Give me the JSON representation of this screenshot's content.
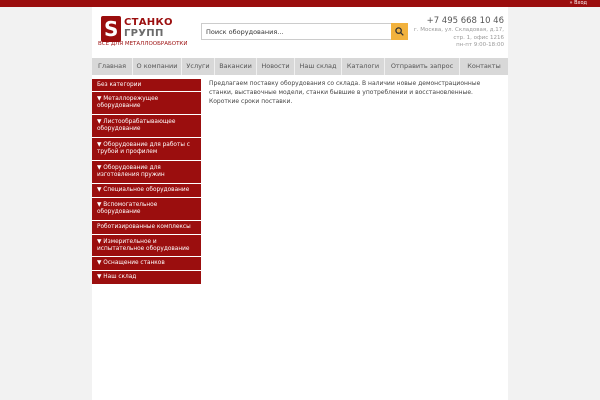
{
  "topbar": {
    "login_label": "» Вход"
  },
  "header": {
    "logo_line1": "СТАНКО",
    "logo_line2": "ГРУПП",
    "logo_mark": "S",
    "tagline": "ВСЁ ДЛЯ МЕТАЛЛООБРАБОТКИ",
    "search_placeholder": "Поиск оборудования...",
    "phone": "+7 495 668 10 46",
    "address_line1": "г. Москва, ул. Складовая, д.17,",
    "address_line2": "стр. 1, офис 1216",
    "hours": "пн-пт 9:00-18:00"
  },
  "nav": {
    "items": [
      {
        "label": "Главная"
      },
      {
        "label": "О компании"
      },
      {
        "label": "Услуги"
      },
      {
        "label": "Вакансии"
      },
      {
        "label": "Новости"
      },
      {
        "label": "Наш склад"
      },
      {
        "label": "Каталоги"
      },
      {
        "label": "Отправить запрос"
      },
      {
        "label": "Контакты"
      }
    ]
  },
  "sidebar": {
    "categories": [
      {
        "label": "Без категории"
      },
      {
        "label": "▼ Металлорежущее оборудование"
      },
      {
        "label": "▼ Листообрабатывающее оборудование"
      },
      {
        "label": "▼ Оборудование для работы с трубой и профилем"
      },
      {
        "label": "▼ Оборудование для изготовления пружин"
      },
      {
        "label": "▼ Специальное оборудование"
      },
      {
        "label": "▼ Вспомогательное оборудование"
      },
      {
        "label": "Роботизированные комплексы"
      },
      {
        "label": "▼ Измерительное и испытательное оборудование"
      },
      {
        "label": "▼ Оснащение станков"
      },
      {
        "label": "▼ Наш склад"
      }
    ]
  },
  "content": {
    "text": "Предлагаем поставку оборудования со склада. В наличии новые демонстрационные станки, выставочные модели, станки бывшие в употреблении и восстановленные. Короткие сроки поставки."
  },
  "colors": {
    "brand": "#9b0e0e",
    "accent": "#f2b23d",
    "nav_bg": "#d8d8d8"
  }
}
